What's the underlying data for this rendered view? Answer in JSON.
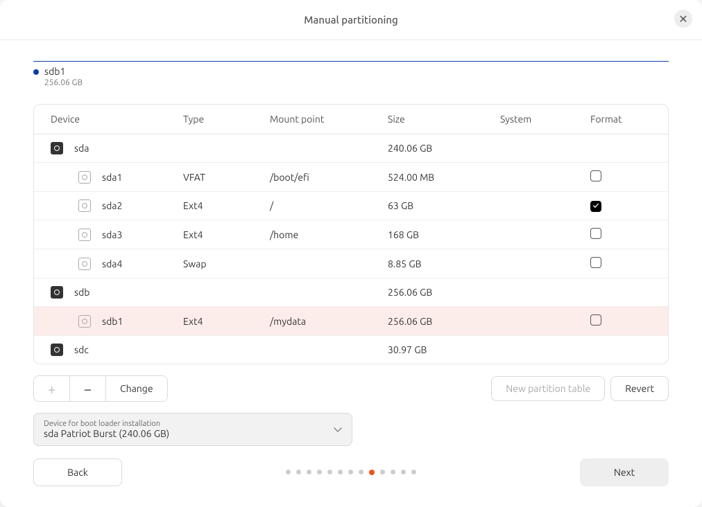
{
  "title": "Manual partitioning",
  "bar": {
    "name": "sdb1",
    "size": "256.06 GB"
  },
  "columns": {
    "device": "Device",
    "type": "Type",
    "mount": "Mount point",
    "size": "Size",
    "system": "System",
    "format": "Format"
  },
  "rows": [
    {
      "indent": 0,
      "iconType": "disk",
      "device": "sda",
      "type": "",
      "mount": "",
      "size": "240.06 GB",
      "system": "",
      "format": null,
      "selected": false
    },
    {
      "indent": 1,
      "iconType": "part",
      "device": "sda1",
      "type": "VFAT",
      "mount": "/boot/efi",
      "size": "524.00 MB",
      "system": "",
      "format": false,
      "selected": false
    },
    {
      "indent": 1,
      "iconType": "part",
      "device": "sda2",
      "type": "Ext4",
      "mount": "/",
      "size": "63 GB",
      "system": "",
      "format": true,
      "selected": false
    },
    {
      "indent": 1,
      "iconType": "part",
      "device": "sda3",
      "type": "Ext4",
      "mount": "/home",
      "size": "168 GB",
      "system": "",
      "format": false,
      "selected": false
    },
    {
      "indent": 1,
      "iconType": "part",
      "device": "sda4",
      "type": "Swap",
      "mount": "",
      "size": "8.85 GB",
      "system": "",
      "format": false,
      "selected": false
    },
    {
      "indent": 0,
      "iconType": "disk",
      "device": "sdb",
      "type": "",
      "mount": "",
      "size": "256.06 GB",
      "system": "",
      "format": null,
      "selected": false
    },
    {
      "indent": 1,
      "iconType": "part",
      "device": "sdb1",
      "type": "Ext4",
      "mount": "/mydata",
      "size": "256.06 GB",
      "system": "",
      "format": false,
      "selected": true
    },
    {
      "indent": 0,
      "iconType": "disk",
      "device": "sdc",
      "type": "",
      "mount": "",
      "size": "30.97 GB",
      "system": "",
      "format": null,
      "selected": false
    }
  ],
  "toolbar": {
    "change": "Change",
    "new_table": "New partition table",
    "revert": "Revert"
  },
  "bootloader": {
    "label": "Device for boot loader installation",
    "value": "sda Patriot Burst (240.06 GB)"
  },
  "footer": {
    "back": "Back",
    "next": "Next",
    "page_count": 13,
    "active_page": 8
  }
}
